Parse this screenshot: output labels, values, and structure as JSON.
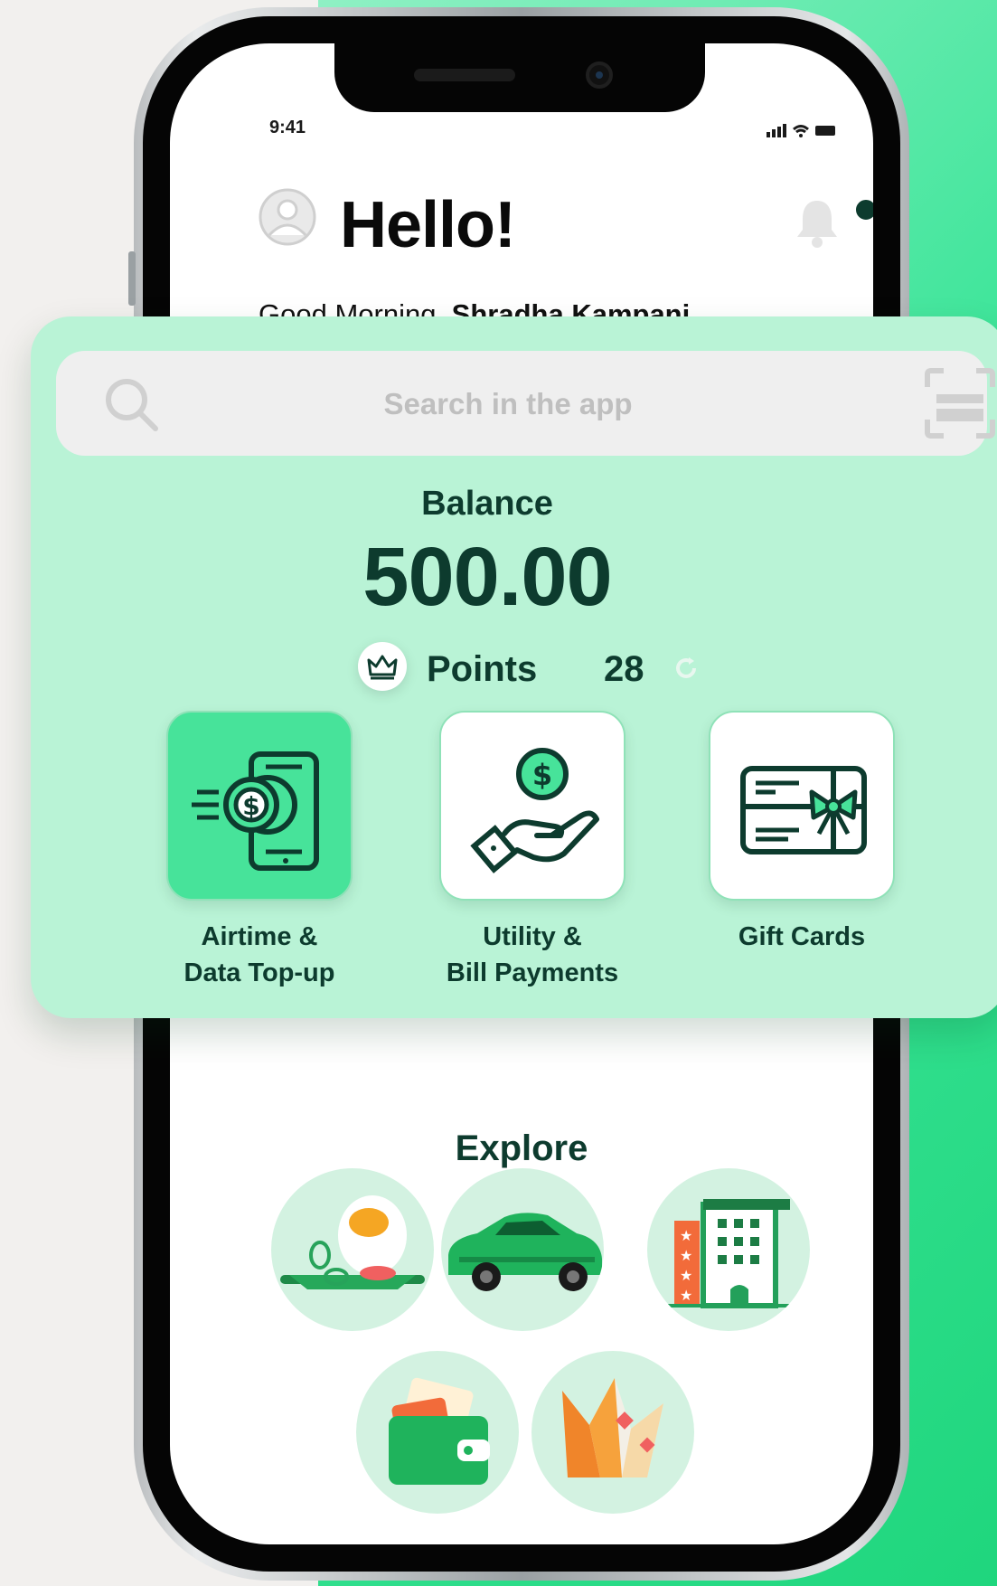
{
  "status_bar": {
    "time": "9:41"
  },
  "header": {
    "title": "Hello!",
    "greeting_prefix": "Good Morning, ",
    "user_name": "Shradha Kampani"
  },
  "search": {
    "placeholder": "Search in the app"
  },
  "balance": {
    "label": "Balance",
    "amount": "500.00"
  },
  "points": {
    "label": "Points",
    "value": "28"
  },
  "services": [
    {
      "label_line1": "Airtime &",
      "label_line2": "Data Top-up",
      "icon": "phone-coin-icon",
      "selected": true
    },
    {
      "label_line1": "Utility &",
      "label_line2": "Bill Payments",
      "icon": "hand-coin-icon",
      "selected": false
    },
    {
      "label_line1": "Gift Cards",
      "label_line2": "",
      "icon": "gift-card-icon",
      "selected": false
    }
  ],
  "explore": {
    "title": "Explore",
    "items": [
      {
        "icon": "food-icon"
      },
      {
        "icon": "car-icon"
      },
      {
        "icon": "hotel-icon"
      },
      {
        "icon": "wallet-icon"
      },
      {
        "icon": "rewards-crown-icon"
      }
    ]
  },
  "colors": {
    "accent": "#47e39a",
    "card": "#b9f3d6",
    "text_dark": "#0d3b2e"
  }
}
